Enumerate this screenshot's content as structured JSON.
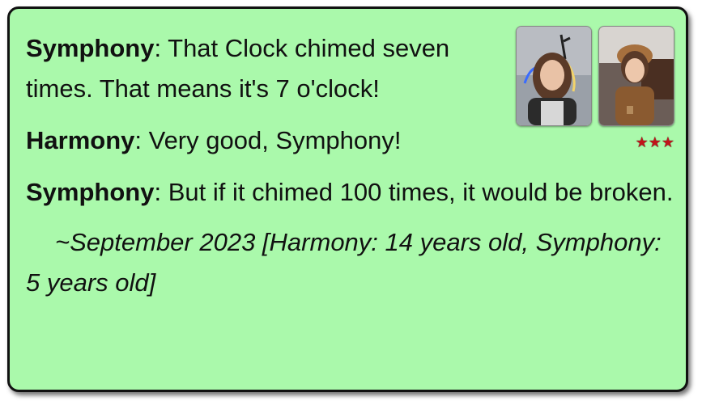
{
  "dialogue": [
    {
      "speaker": "Symphony",
      "line": ": That Clock chimed seven times. That means it's 7 o'clock!"
    },
    {
      "speaker": "Harmony",
      "line": ": Very good, Symphony!"
    },
    {
      "speaker": "Symphony",
      "line": ": But if it chimed 100 times, it would be broken."
    }
  ],
  "caption": "~September 2023 [Harmony: 14 years old, Symphony: 5 years old]",
  "rating": {
    "stars": "★★★",
    "count": 3,
    "color": "#c0141a"
  },
  "colors": {
    "card_background": "#aaf9ab",
    "border": "#111111"
  },
  "photos": [
    {
      "icon": "portrait-photo-harmony"
    },
    {
      "icon": "portrait-photo-symphony"
    }
  ]
}
